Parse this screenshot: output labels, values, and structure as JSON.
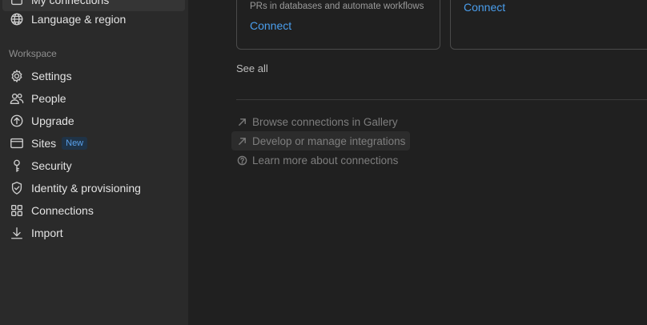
{
  "sidebar": {
    "cut_item": {
      "label": "My connections",
      "icon": "connections-box-icon"
    },
    "language": {
      "label": "Language & region",
      "icon": "globe-icon"
    },
    "workspace_label": "Workspace",
    "items": [
      {
        "label": "Settings",
        "icon": "gear-icon"
      },
      {
        "label": "People",
        "icon": "people-icon"
      },
      {
        "label": "Upgrade",
        "icon": "arrow-up-circle-icon"
      },
      {
        "label": "Sites",
        "icon": "browser-window-icon",
        "badge": "New"
      },
      {
        "label": "Security",
        "icon": "key-icon"
      },
      {
        "label": "Identity & provisioning",
        "icon": "shield-check-icon"
      },
      {
        "label": "Connections",
        "icon": "grid-icon"
      },
      {
        "label": "Import",
        "icon": "download-arrow-icon"
      }
    ]
  },
  "main": {
    "card1": {
      "description": "PRs in databases and automate workflows",
      "connect": "Connect"
    },
    "card2": {
      "connect": "Connect"
    },
    "see_all": "See all",
    "links": [
      {
        "label": "Browse connections in Gallery",
        "icon": "arrow-up-right-icon"
      },
      {
        "label": "Develop or manage integrations",
        "icon": "arrow-up-right-icon"
      },
      {
        "label": "Learn more about connections",
        "icon": "question-circle-icon"
      }
    ]
  },
  "colors": {
    "link": "#4a9eed",
    "sidebar_bg": "#2a2a2a",
    "main_bg": "#202020"
  }
}
